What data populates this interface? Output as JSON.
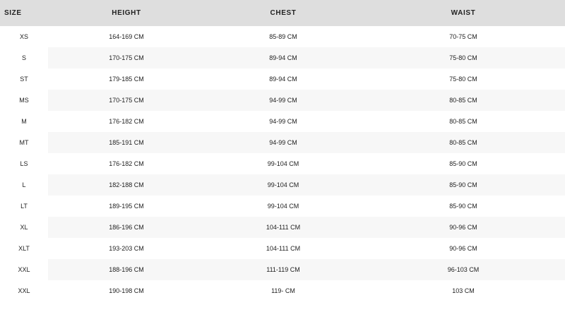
{
  "table": {
    "headers": [
      "SIZE",
      "HEIGHT",
      "CHEST",
      "WAIST"
    ],
    "rows": [
      [
        "XS",
        "164-169 CM",
        "85-89 CM",
        "70-75 CM"
      ],
      [
        "S",
        "170-175 CM",
        "89-94 CM",
        "75-80 CM"
      ],
      [
        "ST",
        "179-185 CM",
        "89-94 CM",
        "75-80 CM"
      ],
      [
        "MS",
        "170-175 CM",
        "94-99 CM",
        "80-85 CM"
      ],
      [
        "M",
        "176-182 CM",
        "94-99 CM",
        "80-85 CM"
      ],
      [
        "MT",
        "185-191 CM",
        "94-99 CM",
        "80-85 CM"
      ],
      [
        "LS",
        "176-182 CM",
        "99-104 CM",
        "85-90 CM"
      ],
      [
        "L",
        "182-188 CM",
        "99-104 CM",
        "85-90 CM"
      ],
      [
        "LT",
        "189-195 CM",
        "99-104 CM",
        "85-90 CM"
      ],
      [
        "XL",
        "186-196 CM",
        "104-111 CM",
        "90-96 CM"
      ],
      [
        "XLT",
        "193-203 CM",
        "104-111 CM",
        "90-96 CM"
      ],
      [
        "XXL",
        "188-196 CM",
        "111-119 CM",
        "96-103 CM"
      ],
      [
        "XXL",
        "190-198 CM",
        "119- CM",
        "103 CM"
      ]
    ]
  },
  "colors": {
    "header_bg": "#dedede",
    "stripe_bg": "#f7f7f7",
    "text": "#222222"
  }
}
